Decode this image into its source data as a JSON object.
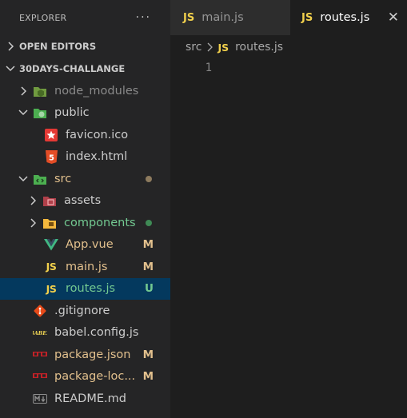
{
  "explorer": {
    "title": "EXPLORER",
    "more": "···",
    "open_editors": "OPEN EDITORS",
    "project": "30DAYS-CHALLANGE",
    "tree": {
      "node_modules": "node_modules",
      "public": "public",
      "favicon": "favicon.ico",
      "index_html": "index.html",
      "src": "src",
      "assets": "assets",
      "components": "components",
      "app_vue": "App.vue",
      "app_vue_status": "M",
      "main_js": "main.js",
      "main_js_status": "M",
      "routes_js": "routes.js",
      "routes_js_status": "U",
      "gitignore": ".gitignore",
      "babel": "babel.config.js",
      "package_json": "package.json",
      "package_json_status": "M",
      "package_lock": "package-loc...",
      "package_lock_status": "M",
      "readme": "README.md"
    }
  },
  "tabs": {
    "tab1": "main.js",
    "tab2": "routes.js",
    "js_badge": "JS",
    "close": "✕"
  },
  "editor": {
    "crumb_folder": "src",
    "crumb_file": "routes.js",
    "line1": "1"
  },
  "colors": {
    "selection": "#04395e",
    "modified": "#e2c08d",
    "untracked": "#73c991",
    "js_yellow": "#f1d04c"
  }
}
